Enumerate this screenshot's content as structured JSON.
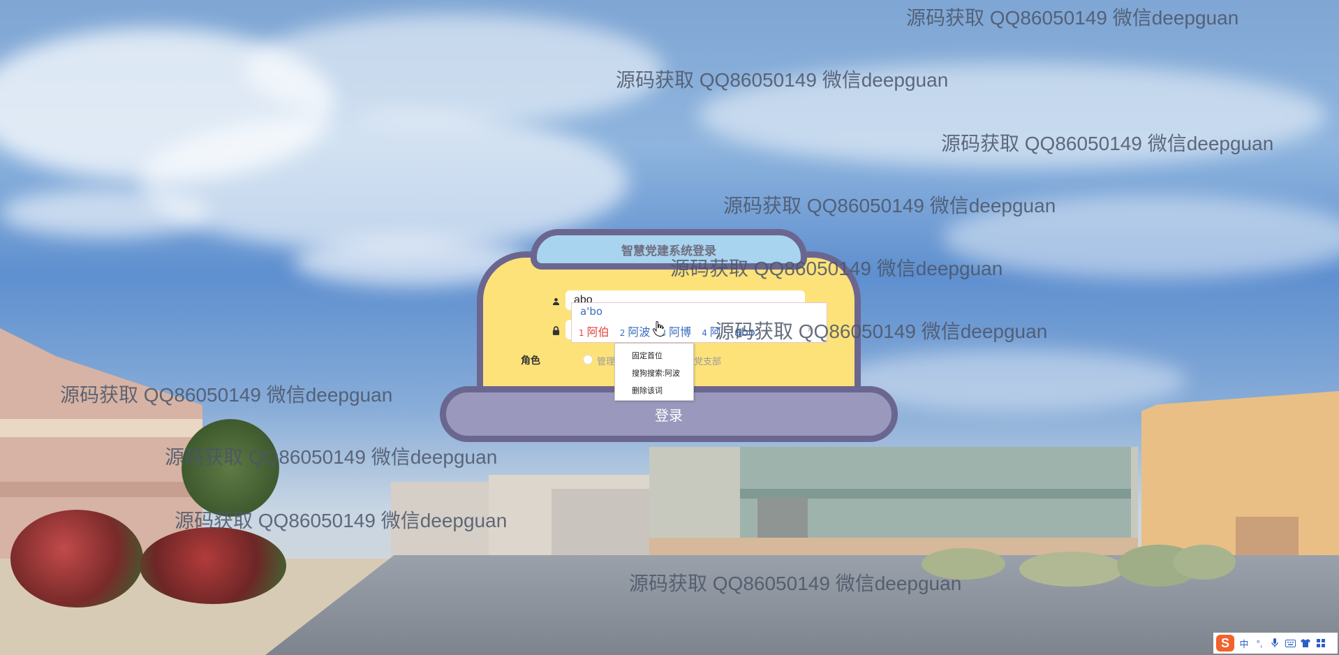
{
  "login": {
    "title": "智慧党建系统登录",
    "username_value": "abo",
    "password_value": "",
    "role_label": "角色",
    "role_options": [
      "管理员",
      "党支部"
    ],
    "submit_label": "登录"
  },
  "ime": {
    "composition": "a'bo",
    "candidates": [
      {
        "num": "1",
        "text": "阿伯"
      },
      {
        "num": "2",
        "text": "阿波"
      },
      {
        "num": "3",
        "text": "阿博"
      },
      {
        "num": "4",
        "text": "阿"
      },
      {
        "num": "",
        "text": "abo"
      }
    ],
    "more": "›",
    "context_menu": [
      "固定首位",
      "搜狗搜索:阿波",
      "删除该词"
    ]
  },
  "toolbar": {
    "logo": "S",
    "mode": "中",
    "punct": "°,",
    "icons": [
      "mic-icon",
      "keyboard-icon",
      "shirt-icon",
      "grid-icon"
    ]
  },
  "watermark": {
    "text": "源码获取 QQ86050149 微信deepguan",
    "color": "#4b5568"
  },
  "colors": {
    "card_border": "#6b6690",
    "card_fill": "#fde27a",
    "title_fill": "#a8d4ef",
    "button_fill": "#9a98bc"
  }
}
